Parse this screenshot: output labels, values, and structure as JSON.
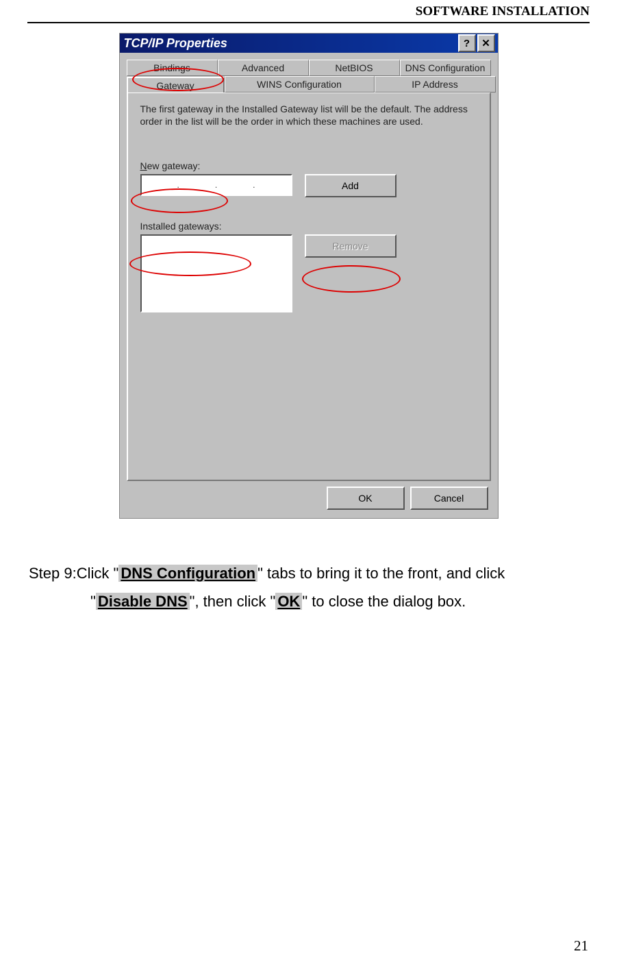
{
  "header": "SOFTWARE INSTALLATION",
  "dialog": {
    "title": "TCP/IP Properties",
    "help_btn": "?",
    "close_btn": "✕",
    "tabs_row1": [
      "Bindings",
      "Advanced",
      "NetBIOS",
      "DNS Configuration"
    ],
    "tabs_row2": [
      "Gateway",
      "WINS Configuration",
      "IP Address"
    ],
    "active_tab": "Gateway",
    "info_text": "The first gateway in the Installed Gateway list will be the default. The address order in the list will be the order in which these machines are used.",
    "new_gateway_label": "New gateway:",
    "add_label": "Add",
    "installed_label": "Installed gateways:",
    "remove_label": "Remove",
    "ok_label": "OK",
    "cancel_label": "Cancel"
  },
  "step": {
    "prefix": "Step 9:Click \"",
    "hl1": "DNS Configuration",
    "mid1": "\" tabs to bring it to the front, and click",
    "line2a": "\"",
    "hl2": "Disable DNS",
    "mid2": "\", then click \"",
    "hl3": "OK",
    "suffix": "\" to close the dialog box."
  },
  "page_number": "21"
}
